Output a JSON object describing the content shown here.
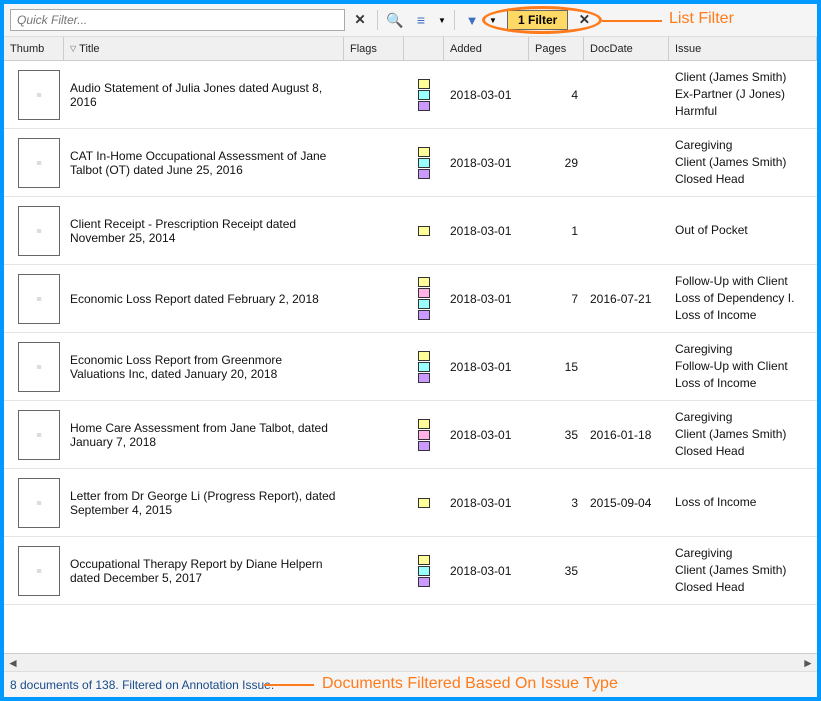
{
  "toolbar": {
    "quick_filter_placeholder": "Quick Filter...",
    "filter_badge": "1 Filter"
  },
  "annotations": {
    "list_filter_label": "List Filter",
    "bottom_label": "Documents Filtered Based On Issue Type"
  },
  "headers": {
    "thumb": "Thumb",
    "title": "Title",
    "flags": "Flags",
    "added": "Added",
    "pages": "Pages",
    "docdate": "DocDate",
    "issue": "Issue"
  },
  "rows": [
    {
      "title": "Audio Statement of Julia Jones dated August 8, 2016",
      "flags": [
        "yellow",
        "cyan",
        "purple"
      ],
      "added": "2018-03-01",
      "pages": "4",
      "docdate": "",
      "issue": "Client (James Smith)\nEx-Partner (J Jones)\nHarmful"
    },
    {
      "title": "CAT In-Home Occupational Assessment of Jane Talbot (OT) dated June 25, 2016",
      "flags": [
        "yellow",
        "cyan",
        "purple"
      ],
      "added": "2018-03-01",
      "pages": "29",
      "docdate": "",
      "issue": "Caregiving\nClient (James Smith)\nClosed Head"
    },
    {
      "title": "Client Receipt - Prescription Receipt dated November 25, 2014",
      "flags": [
        "yellow"
      ],
      "added": "2018-03-01",
      "pages": "1",
      "docdate": "",
      "issue": "Out of Pocket"
    },
    {
      "title": "Economic Loss Report dated February 2, 2018",
      "flags": [
        "yellow",
        "pink",
        "cyan",
        "purple"
      ],
      "added": "2018-03-01",
      "pages": "7",
      "docdate": "2016-07-21",
      "issue": "Follow-Up with Client\nLoss of Dependency I.\nLoss of Income"
    },
    {
      "title": "Economic Loss Report from Greenmore Valuations Inc, dated January 20, 2018",
      "flags": [
        "yellow",
        "cyan",
        "purple"
      ],
      "added": "2018-03-01",
      "pages": "15",
      "docdate": "",
      "issue": "Caregiving\nFollow-Up with Client\nLoss of Income"
    },
    {
      "title": "Home Care Assessment from Jane Talbot, dated January 7, 2018",
      "flags": [
        "yellow",
        "pink",
        "purple"
      ],
      "added": "2018-03-01",
      "pages": "35",
      "docdate": "2016-01-18",
      "issue": "Caregiving\nClient (James Smith)\nClosed Head"
    },
    {
      "title": "Letter from Dr George Li (Progress Report), dated September 4, 2015",
      "flags": [
        "yellow"
      ],
      "added": "2018-03-01",
      "pages": "3",
      "docdate": "2015-09-04",
      "issue": "Loss of Income"
    },
    {
      "title": "Occupational Therapy Report by Diane Helpern dated December 5, 2017",
      "flags": [
        "yellow",
        "cyan",
        "purple"
      ],
      "added": "2018-03-01",
      "pages": "35",
      "docdate": "",
      "issue": "Caregiving\nClient (James Smith)\nClosed Head"
    }
  ],
  "status": {
    "text": "8 documents of 138.  Filtered on Annotation Issue."
  }
}
